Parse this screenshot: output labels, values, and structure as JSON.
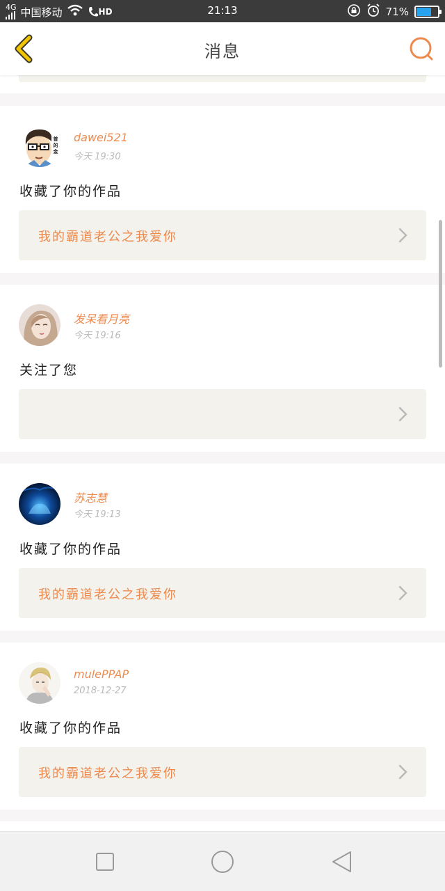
{
  "status_bar": {
    "signal_type": "4G",
    "carrier": "中国移动",
    "hd_badge": "HD",
    "time": "21:13",
    "battery_text": "71%",
    "battery_level": 0.71,
    "icons": [
      "signal-icon",
      "wifi-icon",
      "hd-call-icon",
      "rotation-lock-icon",
      "alarm-icon",
      "battery-icon"
    ]
  },
  "header": {
    "title": "消息",
    "back_icon": "chevron-left-icon",
    "search_icon": "search-icon",
    "accent_color": "#ed8a4e",
    "back_color": "#f3c400"
  },
  "messages": [
    {
      "username": "dawei521",
      "time": "今天 19:30",
      "action": "收藏了你的作品",
      "work_title": "我的霸道老公之我爱你",
      "avatar": "cartoon-glasses-avatar"
    },
    {
      "username": "发呆看月亮",
      "time": "今天 19:16",
      "action": "关注了您",
      "work_title": "",
      "avatar": "illustrated-girl-avatar"
    },
    {
      "username": "苏志慧",
      "time": "今天 19:13",
      "action": "收藏了你的作品",
      "work_title": "我的霸道老公之我爱你",
      "avatar": "blue-cave-avatar"
    },
    {
      "username": "mulePPAP",
      "time": "2018-12-27",
      "action": "收藏了你的作品",
      "work_title": "我的霸道老公之我爱你",
      "avatar": "anime-boy-avatar"
    }
  ],
  "nav_bar": {
    "buttons": [
      "recent-apps-icon",
      "home-icon",
      "back-triangle-icon"
    ]
  }
}
